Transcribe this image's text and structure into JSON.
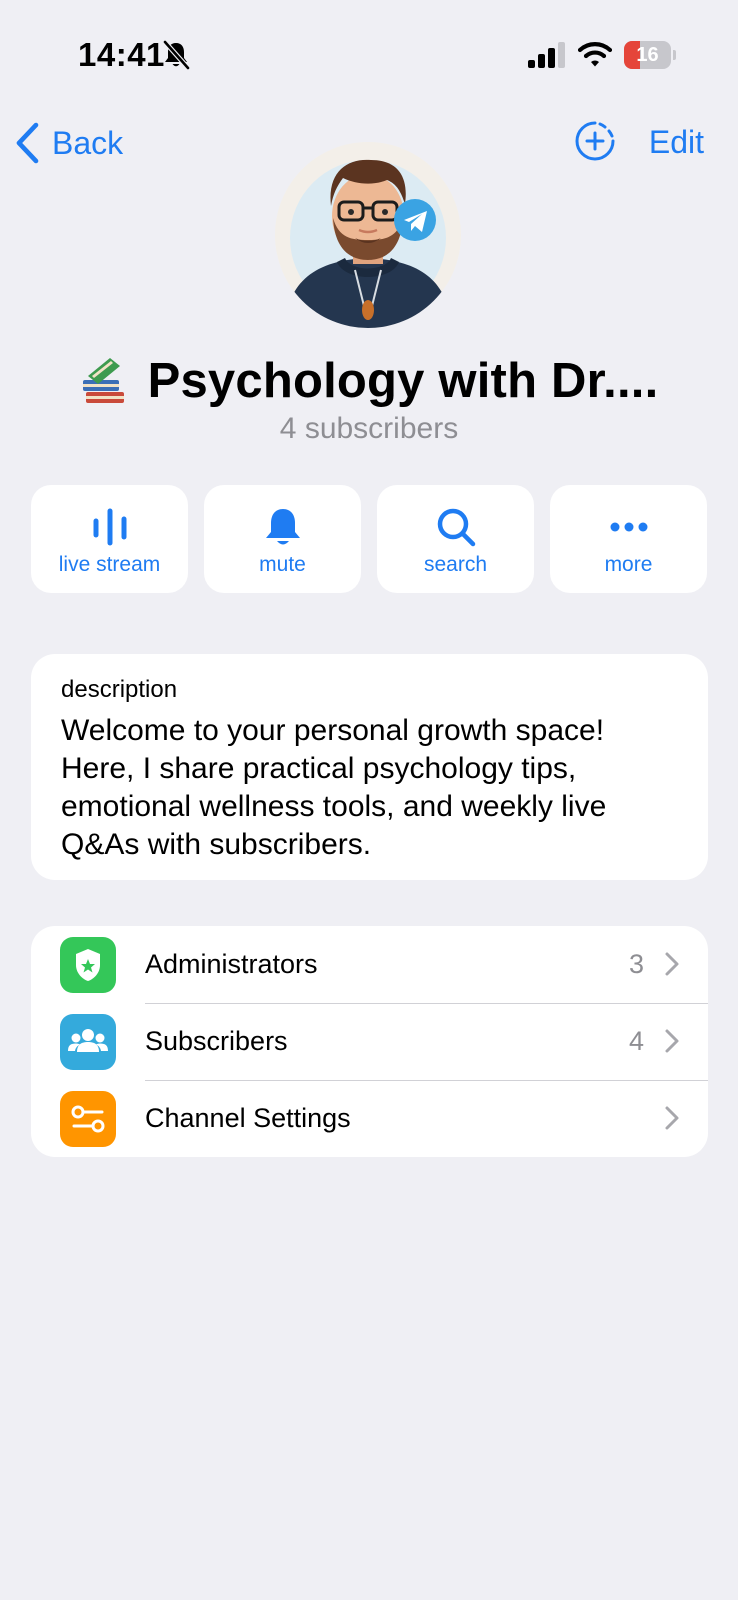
{
  "status_bar": {
    "time": "14:41",
    "battery_level": "16",
    "battery_fraction": 0.16,
    "icons": [
      "bell-slash-icon",
      "cellular-signal-icon",
      "wifi-icon",
      "battery-icon"
    ]
  },
  "nav": {
    "back_label": "Back",
    "edit_label": "Edit",
    "add_story_icon": "plus-circle-dashed-icon"
  },
  "channel": {
    "title": "Psychology with Dr....",
    "title_emoji": "books-emoji",
    "subscribers_text": "4 subscribers"
  },
  "actions": [
    {
      "label": "live stream",
      "icon": "live-stream-icon"
    },
    {
      "label": "mute",
      "icon": "bell-icon"
    },
    {
      "label": "search",
      "icon": "search-icon"
    },
    {
      "label": "more",
      "icon": "more-icon"
    }
  ],
  "description": {
    "heading": "description",
    "text": "Welcome to your personal growth space! Here, I share practical psychology tips, emotional wellness tools, and weekly live Q&As with subscribers."
  },
  "settings_list": [
    {
      "label": "Administrators",
      "count": "3",
      "icon": "shield-star-icon",
      "color": "#34C759"
    },
    {
      "label": "Subscribers",
      "count": "4",
      "icon": "people-icon",
      "color": "#34AADC"
    },
    {
      "label": "Channel Settings",
      "count": "",
      "icon": "sliders-icon",
      "color": "#FF9500"
    }
  ],
  "colors": {
    "accent": "#1F7CF2",
    "background": "#EFEFF4",
    "secondary_text": "#8E8E93"
  }
}
